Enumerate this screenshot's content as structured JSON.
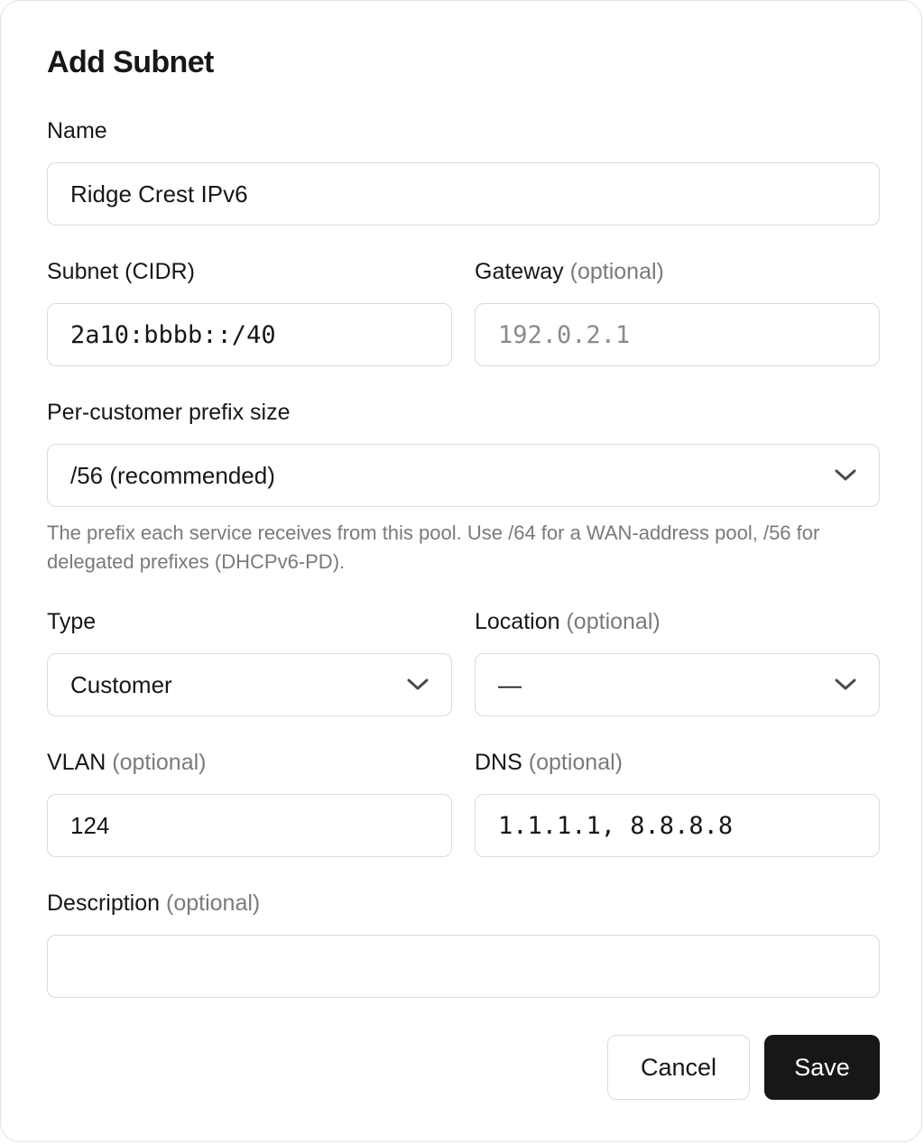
{
  "dialog": {
    "title": "Add Subnet",
    "name": {
      "label": "Name",
      "value": "Ridge Crest IPv6"
    },
    "subnet": {
      "label": "Subnet (CIDR)",
      "value": "2a10:bbbb::/40"
    },
    "gateway": {
      "label": "Gateway",
      "optional": "(optional)",
      "placeholder": "192.0.2.1"
    },
    "prefix_size": {
      "label": "Per-customer prefix size",
      "selected": "/56 (recommended)",
      "help": "The prefix each service receives from this pool. Use /64 for a WAN-address pool, /56 for delegated prefixes (DHCPv6-PD)."
    },
    "type": {
      "label": "Type",
      "selected": "Customer"
    },
    "location": {
      "label": "Location",
      "optional": "(optional)",
      "selected": "—"
    },
    "vlan": {
      "label": "VLAN",
      "optional": "(optional)",
      "value": "124"
    },
    "dns": {
      "label": "DNS",
      "optional": "(optional)",
      "value": "1.1.1.1, 8.8.8.8"
    },
    "description": {
      "label": "Description",
      "optional": "(optional)",
      "value": ""
    },
    "buttons": {
      "cancel": "Cancel",
      "save": "Save"
    },
    "colors": {
      "primary_button": "#171717",
      "border": "#dadada",
      "muted_text": "#7a7a7a"
    },
    "icons": {
      "dropdown": "chevron-down-icon"
    }
  }
}
